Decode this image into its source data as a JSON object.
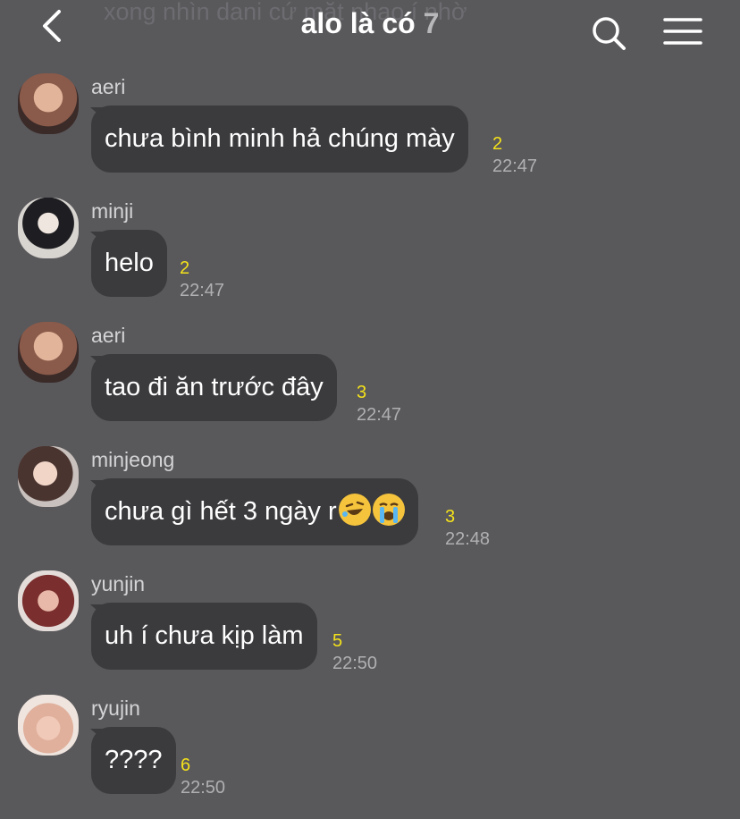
{
  "header": {
    "ghost_text": "xong nhìn dani cứ mặt nhao í nhờ",
    "title": "alo là có",
    "member_count": "7"
  },
  "messages": [
    {
      "sender": "aeri",
      "text": "chưa bình minh hả chúng mày",
      "unread": "2",
      "time": "22:47",
      "avatar_color": "#8a5a4a"
    },
    {
      "sender": "minji",
      "text": "helo",
      "unread": "2",
      "time": "22:47",
      "avatar_color": "#2a2a2e"
    },
    {
      "sender": "aeri",
      "text": "tao đi ăn trước đây",
      "unread": "3",
      "time": "22:47",
      "avatar_color": "#8a5a4a"
    },
    {
      "sender": "minjeong",
      "text": "chưa gì hết 3 ngày r",
      "unread": "3",
      "time": "22:48",
      "avatar_color": "#6b4a42",
      "emojis": [
        "rolling-on-floor-laughing-emoji",
        "loudly-crying-emoji"
      ]
    },
    {
      "sender": "yunjin",
      "text": "uh í chưa kịp làm",
      "unread": "5",
      "time": "22:50",
      "avatar_color": "#7a2e2e"
    },
    {
      "sender": "ryujin",
      "text": "????",
      "unread": "6",
      "time": "22:50",
      "avatar_color": "#d9b3a3"
    }
  ],
  "colors": {
    "background": "#59585b",
    "bubble": "#3b3a3d",
    "unread": "#f4e21a",
    "time": "#b0b0b2"
  }
}
